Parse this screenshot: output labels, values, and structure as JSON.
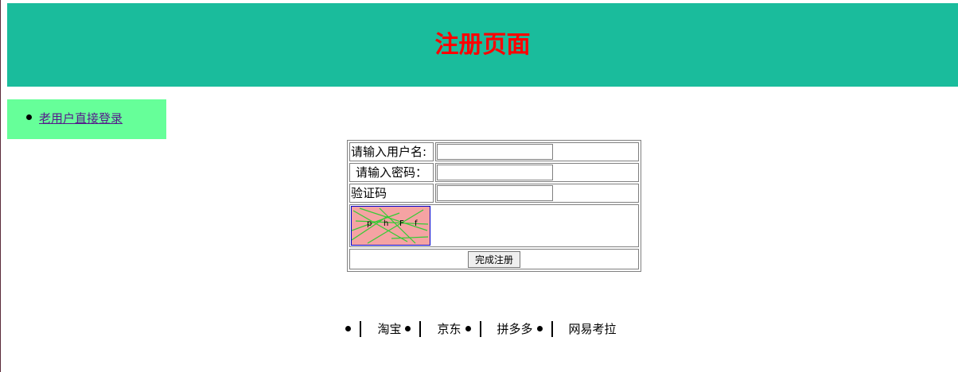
{
  "header": {
    "title": "注册页面"
  },
  "sidebar": {
    "items": [
      {
        "label": "老用户直接登录"
      }
    ]
  },
  "form": {
    "username_label": "请输入用户名:",
    "username_value": "",
    "password_label": "请输入密码：",
    "password_value": "",
    "captcha_label": "验证码",
    "captcha_value": "",
    "captcha_chars": [
      "p",
      "h",
      "F",
      "f"
    ],
    "submit_label": "完成注册"
  },
  "bottom_nav": {
    "items": [
      "淘宝",
      "京东",
      "拼多多",
      "网易考拉"
    ]
  },
  "colors": {
    "header_bg": "#1abc9c",
    "title": "#ff0000",
    "sidebar_bg": "#66ff99",
    "link_visited": "#551a8b",
    "captcha_bg": "#f5a3a3",
    "captcha_lines": "#33cc33"
  }
}
